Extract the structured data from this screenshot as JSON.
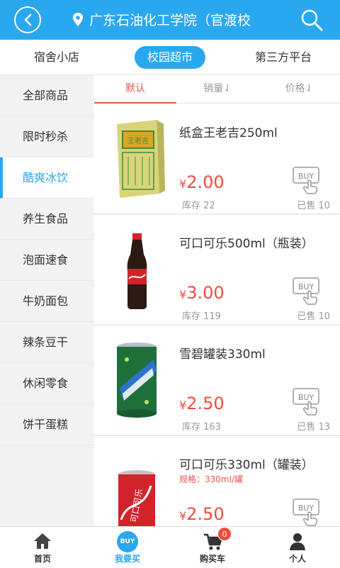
{
  "header": {
    "title": "广东石油化工学院（官渡校",
    "back_icon": "back-arrow-icon",
    "location_icon": "location-pin-icon",
    "search_icon": "search-icon",
    "color": "#29a8f0"
  },
  "top_tabs": [
    {
      "label": "宿舍小店",
      "active": false
    },
    {
      "label": "校园超市",
      "active": true
    },
    {
      "label": "第三方平台",
      "active": false
    }
  ],
  "sidebar": {
    "items": [
      {
        "label": "全部商品"
      },
      {
        "label": "限时秒杀"
      },
      {
        "label": "酷爽冰饮",
        "active": true
      },
      {
        "label": "养生食品"
      },
      {
        "label": "泡面速食"
      },
      {
        "label": "牛奶面包"
      },
      {
        "label": "辣条豆干"
      },
      {
        "label": "休闲零食"
      },
      {
        "label": "饼干蛋糕"
      }
    ]
  },
  "sort": {
    "default": "默认",
    "sales": "销量⇃",
    "price": "价格⇃"
  },
  "products": [
    {
      "name": "纸盒王老吉250ml",
      "price": "2.00",
      "stock": "库存 22",
      "sold": "已售 10",
      "spec": ""
    },
    {
      "name": "可口可乐500ml（瓶装）",
      "price": "3.00",
      "stock": "库存 119",
      "sold": "已售 10",
      "spec": ""
    },
    {
      "name": "雪碧罐装330ml",
      "price": "2.50",
      "stock": "库存 163",
      "sold": "已售 13",
      "spec": ""
    },
    {
      "name": "可口可乐330ml（罐装）",
      "price": "2.50",
      "stock": "",
      "sold": "",
      "spec": "规格：330ml/罐"
    }
  ],
  "currency": "¥",
  "buy_label": "BUY",
  "bottom_nav": {
    "home": "首页",
    "buy": "我要买",
    "cart": "购买车",
    "me": "个人",
    "cart_count": "0",
    "buy_icon_text": "BUY"
  },
  "colors": {
    "accent": "#29a8f0",
    "price": "#f04d3f",
    "active_sort": "#e8554e"
  }
}
